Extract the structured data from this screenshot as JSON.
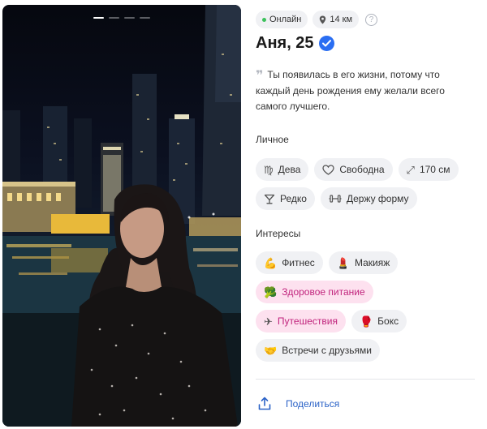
{
  "photo": {
    "count": 4,
    "active": 0
  },
  "status": {
    "online": "Онлайн",
    "distance": "14 км",
    "help": "?"
  },
  "profile": {
    "name_age": "Аня, 25"
  },
  "quote": "Ты появилась в его жизни, потому что каждый день рождения ему желали всего самого лучшего.",
  "personal": {
    "title": "Личное",
    "zodiac": "Дева",
    "relationship": "Свободна",
    "height": "170 см",
    "drinking": "Редко",
    "fitness": "Держу форму"
  },
  "interests": {
    "title": "Интересы",
    "fitness": "Фитнес",
    "makeup": "Макияж",
    "healthy_food": "Здоровое питание",
    "travel": "Путешествия",
    "boxing": "Бокс",
    "friends": "Встречи с друзьями"
  },
  "actions": {
    "share": "Поделиться"
  },
  "colors": {
    "accent_link": "#2a62c7",
    "verified": "#2a6ef2",
    "online": "#3cc15c",
    "highlight_bg": "#fde1ef",
    "highlight_text": "#c1247d"
  },
  "icons": {
    "online": "online-dot-icon",
    "distance": "location-pin-icon",
    "help": "question-icon",
    "verified": "verified-check-icon",
    "zodiac": "virgo-icon",
    "relationship": "heart-icon",
    "height": "resize-arrows-icon",
    "drinking": "glass-icon",
    "fitness": "dumbbell-icon",
    "share": "share-upload-icon"
  }
}
